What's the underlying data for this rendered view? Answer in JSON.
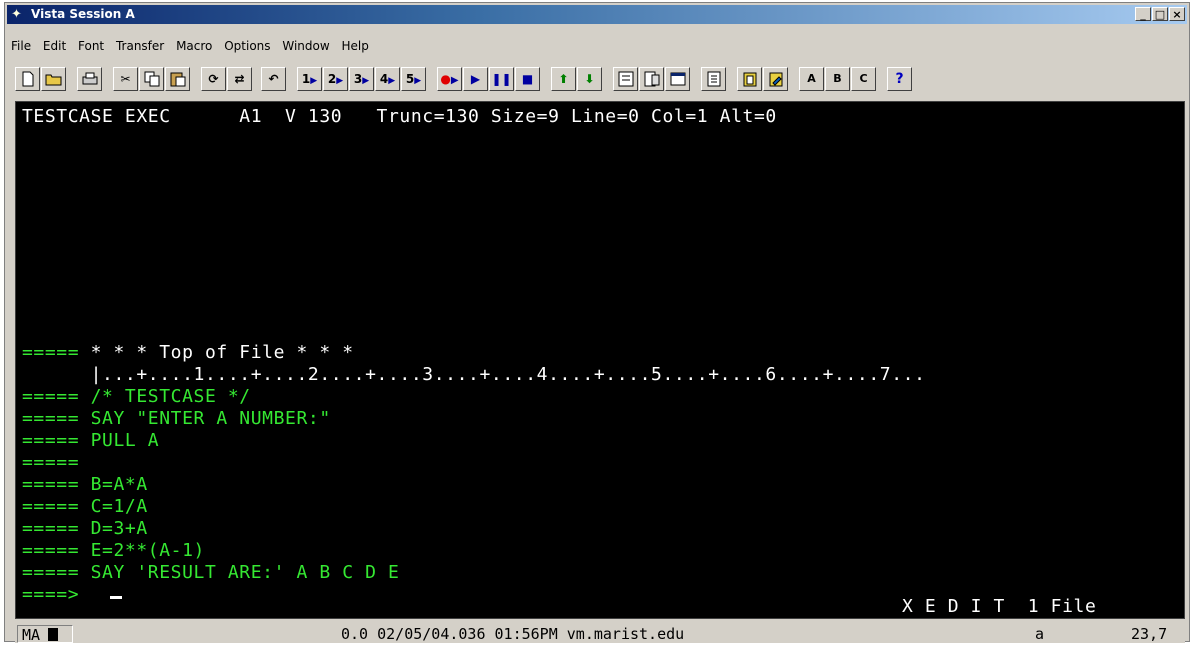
{
  "window": {
    "title": "Vista Session A"
  },
  "window_controls": {
    "minimize": "_",
    "maximize": "□",
    "close": "×"
  },
  "menu": [
    "File",
    "Edit",
    "Font",
    "Transfer",
    "Macro",
    "Options",
    "Window",
    "Help"
  ],
  "toolbar": {
    "macro_labels": [
      "1",
      "2",
      "3",
      "4",
      "5"
    ],
    "letter_buttons": [
      "A",
      "B",
      "C"
    ],
    "help": "?"
  },
  "terminal": {
    "header": "TESTCASE EXEC      A1  V 130   Trunc=130 Size=9 Line=0 Col=1 Alt=0",
    "lines": [
      {
        "prefix": "=====",
        "text": " * * * Top of File * * *"
      },
      {
        "prefix": "     ",
        "text": " |...+....1....+....2....+....3....+....4....+....5....+....6....+....7..."
      },
      {
        "prefix": "=====",
        "text": " /* TESTCASE */"
      },
      {
        "prefix": "=====",
        "text": " SAY \"ENTER A NUMBER:\""
      },
      {
        "prefix": "=====",
        "text": " PULL A"
      },
      {
        "prefix": "=====",
        "text": ""
      },
      {
        "prefix": "=====",
        "text": " B=A*A"
      },
      {
        "prefix": "=====",
        "text": " C=1/A"
      },
      {
        "prefix": "=====",
        "text": " D=3+A"
      },
      {
        "prefix": "=====",
        "text": " E=2**(A-1)"
      },
      {
        "prefix": "=====",
        "text": " SAY 'RESULT ARE:' A B C D E"
      }
    ],
    "command_prompt": "====>",
    "mode_line": "X E D I T  1 File"
  },
  "status": {
    "left": "MA",
    "center": "0.0 02/05/04.036 01:56PM vm.marist.edu",
    "mode": "a",
    "position": "23,7"
  }
}
